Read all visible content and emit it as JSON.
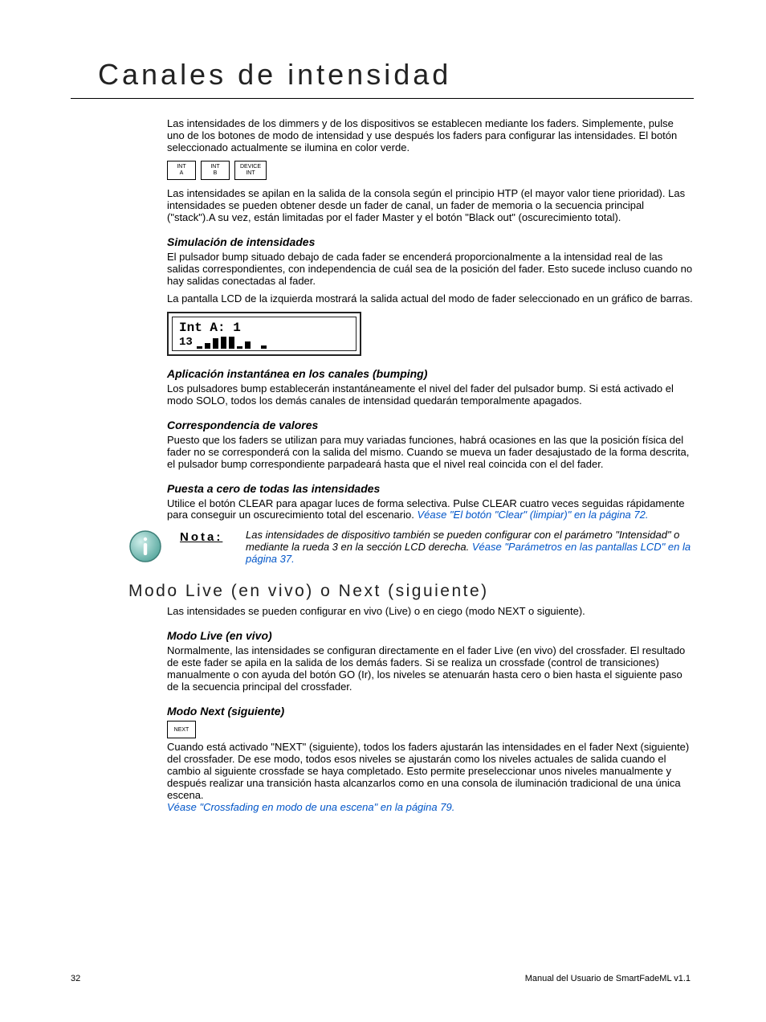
{
  "title": "Canales de intensidad",
  "intro": "Las intensidades de los dimmers y de los dispositivos se establecen mediante los faders. Simplemente, pulse uno de los botones de modo de intensidad y use después los faders para configurar las intensidades. El botón seleccionado actualmente se ilumina en color verde.",
  "buttons": {
    "intA_l1": "INT",
    "intA_l2": "A",
    "intB_l1": "INT",
    "intB_l2": "B",
    "device_l1": "DEVICE",
    "device_l2": "INT"
  },
  "para2": "Las intensidades se apilan en la salida de la consola según el principio HTP (el mayor valor tiene prioridad). Las intensidades se pueden obtener desde un fader de canal, un fader de memoria o la secuencia principal (\"stack\").A su vez, están limitadas por el fader Master y el botón \"Black out\" (oscurecimiento total).",
  "sim_h": "Simulación de intensidades",
  "sim_p1": "El pulsador bump situado debajo de cada fader se encenderá proporcionalmente a la intensidad real de las salidas correspondientes, con independencia de cuál sea de la posición del fader. Esto sucede incluso cuando no hay salidas conectadas al fader.",
  "sim_p2": "La pantalla LCD de la izquierda mostrará la salida actual del modo de fader seleccionado en un gráfico de barras.",
  "lcd_line1": "Int A: 1",
  "lcd_num": "13",
  "bump_h": "Aplicación instantánea en los canales (bumping)",
  "bump_p": "Los pulsadores bump establecerán instantáneamente el nivel del fader del pulsador bump. Si está activado el modo SOLO, todos los demás canales de intensidad quedarán temporalmente apagados.",
  "corr_h": "Correspondencia de valores",
  "corr_p": "Puesto que los faders se utilizan para muy variadas funciones, habrá ocasiones en las que la posición física del fader no se corresponderá con la salida del mismo. Cuando se mueva un fader desajustado de la forma descrita, el pulsador bump correspondiente parpadeará hasta que el nivel real coincida con el del fader.",
  "zero_h": "Puesta a cero de todas las intensidades",
  "zero_p": "Utilice el botón CLEAR para apagar luces de forma selectiva. Pulse CLEAR cuatro veces seguidas rápidamente para conseguir un oscurecimiento total del escenario. ",
  "zero_link": "Véase \"El botón \"Clear\" (limpiar)\" en la página  72.",
  "note_label": "Nota:",
  "note_text": "Las intensidades de dispositivo también se pueden configurar con el parámetro \"Intensidad\" o mediante la rueda 3 en la sección LCD derecha. ",
  "note_link": "Véase \"Parámetros en las pantallas LCD\" en la página  37.",
  "h2": "Modo Live (en vivo) o Next (siguiente)",
  "live_intro": "Las intensidades se pueden configurar en vivo (Live) o en ciego (modo NEXT o siguiente).",
  "live_h": "Modo Live (en vivo)",
  "live_p": "Normalmente, las intensidades se configuran directamente en el fader Live (en vivo) del crossfader. El resultado de este fader se apila en la salida de los demás faders. Si se realiza un crossfade (control de transiciones) manualmente o con ayuda del botón GO (Ir), los niveles se atenuarán hasta cero o bien hasta el siguiente paso de la secuencia principal del crossfader.",
  "next_h": "Modo Next (siguiente)",
  "next_btn": "NEXT",
  "next_p": "Cuando está activado \"NEXT\" (siguiente), todos los faders ajustarán las intensidades en el fader Next (siguiente) del crossfader. De ese modo, todos esos niveles se ajustarán como los niveles actuales de salida cuando el cambio al siguiente crossfade se haya completado. Esto permite preseleccionar unos niveles manualmente y después realizar una transición hasta alcanzarlos como en una consola de iluminación tradicional de una única escena. ",
  "next_link": "Véase \"Crossfading en modo de una escena\" en la página  79.",
  "footer_page": "32",
  "footer_right": "Manual del Usuario de SmartFadeML v1.1"
}
